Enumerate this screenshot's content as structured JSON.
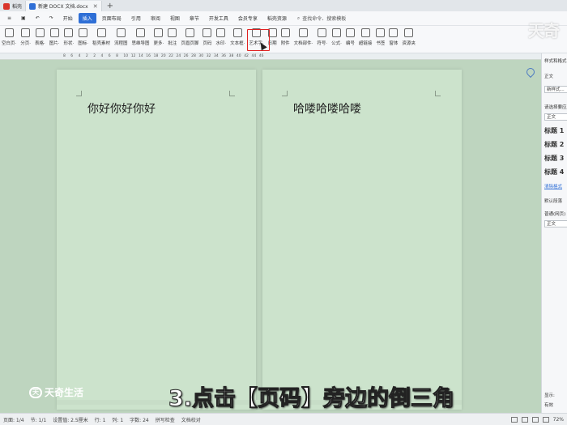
{
  "tabs": [
    {
      "label": "稻壳",
      "color": "#d9352b"
    },
    {
      "label": "新建 DOCX 文档.docx",
      "color": "#2f6fd6"
    }
  ],
  "menu": [
    "开始",
    "插入",
    "页面布局",
    "引用",
    "审阅",
    "视图",
    "章节",
    "开发工具",
    "会员专享",
    "稻壳资源"
  ],
  "menu_active": "插入",
  "search_placeholder": "查找命令、搜索模板",
  "ribbon": [
    {
      "label": "空白页·",
      "icon": "blank-page-icon"
    },
    {
      "label": "分页·",
      "icon": "page-break-icon"
    },
    {
      "label": "表格·",
      "icon": "table-icon"
    },
    {
      "label": "图片·",
      "icon": "image-icon"
    },
    {
      "label": "形状·",
      "icon": "shape-icon"
    },
    {
      "label": "图标·",
      "icon": "icon-library-icon"
    },
    {
      "label": "稻壳素材",
      "icon": "material-icon"
    },
    {
      "label": "流程图",
      "icon": "flowchart-icon"
    },
    {
      "label": "思维导图",
      "icon": "mindmap-icon"
    },
    {
      "label": "更多·",
      "icon": "more-icon"
    },
    {
      "label": "批注",
      "icon": "comment-icon"
    },
    {
      "label": "页眉页脚",
      "icon": "header-footer-icon"
    },
    {
      "label": "页码",
      "icon": "page-number-icon"
    },
    {
      "label": "水印·",
      "icon": "watermark-icon"
    },
    {
      "label": "文本框·",
      "icon": "textbox-icon"
    },
    {
      "label": "艺术字·",
      "icon": "wordart-icon"
    },
    {
      "label": "日期",
      "icon": "date-icon"
    },
    {
      "label": "附件",
      "icon": "attachment-icon"
    },
    {
      "label": "文档部件·",
      "icon": "doc-parts-icon"
    },
    {
      "label": "符号·",
      "icon": "symbol-icon"
    },
    {
      "label": "公式·",
      "icon": "formula-icon"
    },
    {
      "label": "编号",
      "icon": "numbering-icon"
    },
    {
      "label": "超链接",
      "icon": "hyperlink-icon"
    },
    {
      "label": "书签",
      "icon": "bookmark-icon"
    },
    {
      "label": "窗体",
      "icon": "form-icon"
    },
    {
      "label": "资源夹",
      "icon": "resource-icon"
    }
  ],
  "ribbon_small": {
    "chart": "图表",
    "smart": "智能图形",
    "object": "对象",
    "dropcap": "首字下沉",
    "crossref": "交叉引用"
  },
  "ruler_ticks": [
    "8",
    "6",
    "4",
    "2",
    "2",
    "4",
    "6",
    "8",
    "10",
    "12",
    "14",
    "16",
    "18",
    "20",
    "22",
    "24",
    "26",
    "28",
    "30",
    "32",
    "34",
    "36",
    "38",
    "40",
    "42",
    "44",
    "46"
  ],
  "pages": [
    {
      "text": "你好你好你好"
    },
    {
      "text": "哈喽哈喽哈喽"
    }
  ],
  "panel": {
    "title": "样式和格式",
    "current": "正文",
    "new_style": "新样式...",
    "choose_label": "请选择要应用",
    "styles": [
      "正文",
      "标题 1",
      "标题 2",
      "标题 3",
      "标题 4"
    ],
    "clear": "清除格式",
    "default_label": "默认段落",
    "show_label": "普通(网页)",
    "show_value": "正文",
    "bottom1": "显示:",
    "bottom2": "有效"
  },
  "status": {
    "page": "页面: 1/4",
    "section": "节: 1/1",
    "setvalue": "设置值: 2.5厘米",
    "row": "行: 1",
    "col": "列: 1",
    "words": "字数: 24",
    "spell": "拼写检查",
    "proof": "文档校对",
    "zoom": "72%"
  },
  "overlay": {
    "subtitle": "3.点击【页码】旁边的倒三角",
    "brand": "天奇生活",
    "brand_logo": "天",
    "corner_brand": "天奇"
  }
}
